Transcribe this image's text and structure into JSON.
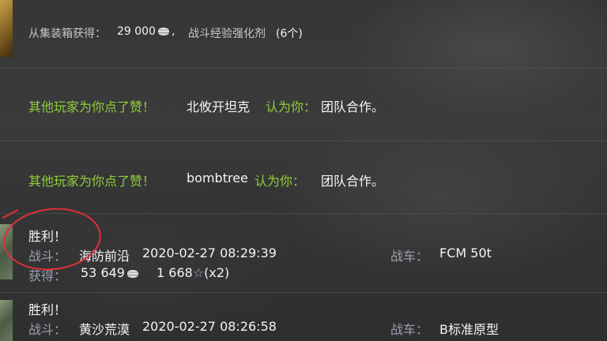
{
  "row1": {
    "label": "从集装箱获得：",
    "amount": "29 000",
    "separator": ",",
    "item": "战斗经验强化剂",
    "count": "(6个)"
  },
  "row2": {
    "prefix": "其他玩家为你点了赞！",
    "player": "北攸开坦克",
    "verb": "认为你：",
    "trait": "团队合作。"
  },
  "row3": {
    "prefix": "其他玩家为你点了赞！",
    "player": "bombtree",
    "verb": "认为你：",
    "trait": "团队合作。"
  },
  "battles": [
    {
      "result": "胜利！",
      "battle_label": "战斗：",
      "map": "海防前沿",
      "datetime": "2020-02-27 08:29:39",
      "vehicle_label": "战车：",
      "vehicle": "FCM 50t",
      "earned_label": "获得：",
      "credits": "53 649",
      "xp": "1 668",
      "multiplier": "(x2)"
    },
    {
      "result": "胜利！",
      "battle_label": "战斗：",
      "map": "黄沙荒漠",
      "datetime": "2020-02-27 08:26:58",
      "vehicle_label": "战车：",
      "vehicle": "B标准原型"
    }
  ],
  "colors": {
    "accent_green": "#8fcf3a",
    "annotation_red": "#e0303a"
  }
}
